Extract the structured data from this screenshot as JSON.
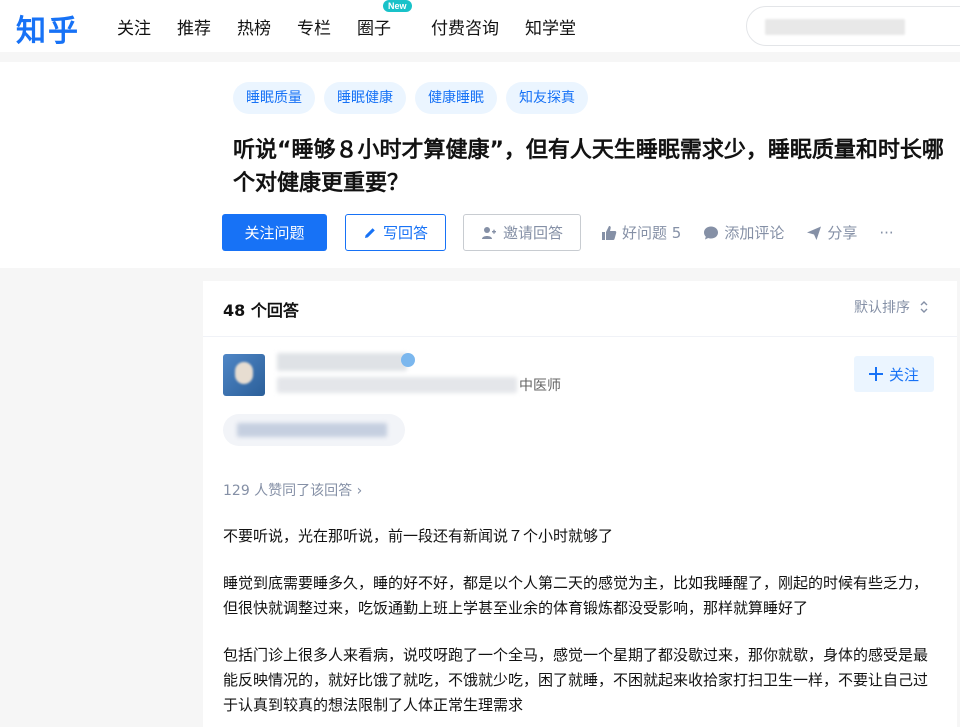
{
  "header": {
    "logo": "知乎",
    "nav": [
      {
        "label": "关注"
      },
      {
        "label": "推荐"
      },
      {
        "label": "热榜"
      },
      {
        "label": "专栏"
      },
      {
        "label": "圈子",
        "badge": "New"
      },
      {
        "label": "付费咨询"
      },
      {
        "label": "知学堂"
      }
    ],
    "brand_color": "#1772f6"
  },
  "question": {
    "tags": [
      "睡眠质量",
      "睡眠健康",
      "健康睡眠",
      "知友探真"
    ],
    "title": "听说“睡够８小时才算健康”，但有人天生睡眠需求少，睡眠质量和时长哪个对健康更重要？",
    "actions": {
      "follow": "关注问题",
      "write": "写回答",
      "invite": "邀请回答",
      "good_question": "好问题 5",
      "comment": "添加评论",
      "share": "分享",
      "more": "···"
    }
  },
  "answers": {
    "count_label": "48 个回答",
    "sort_label": "默认排序",
    "first": {
      "author_title_suffix": "中医师",
      "follow_label": "关注",
      "voters": "129 人赞同了该回答 ›",
      "paragraphs": [
        "不要听说，光在那听说，前一段还有新闻说７个小时就够了",
        "睡觉到底需要睡多久，睡的好不好，都是以个人第二天的感觉为主，比如我睡醒了，刚起的时候有些乏力，但很快就调整过来，吃饭通勤上班上学甚至业余的体育锻炼都没受影响，那样就算睡好了",
        "包括门诊上很多人来看病，说哎呀跑了一个全马，感觉一个星期了都没歇过来，那你就歇，身体的感受是最能反映情况的，就好比饿了就吃，不饿就少吃，困了就睡，不困就起来收拾家打扫卫生一样，不要让自己过于认真到较真的想法限制了人体正常生理需求"
      ]
    }
  }
}
